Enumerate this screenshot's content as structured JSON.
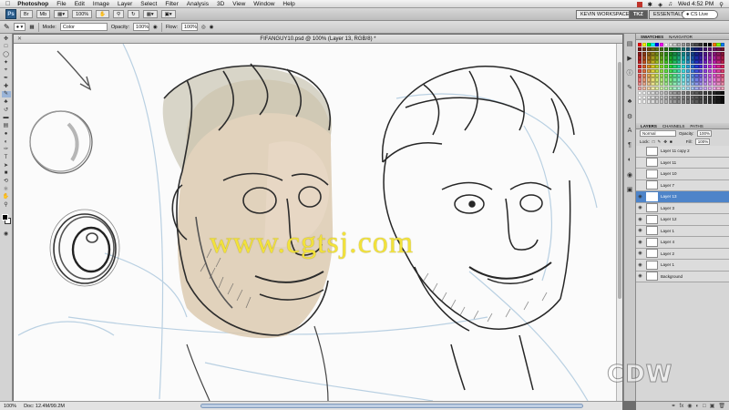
{
  "menubar": {
    "apple_icon": "apple-icon",
    "app_name": "Photoshop",
    "items": [
      "File",
      "Edit",
      "Image",
      "Layer",
      "Select",
      "Filter",
      "Analysis",
      "3D",
      "View",
      "Window",
      "Help"
    ],
    "clock": "Wed 4:52 PM"
  },
  "appbar": {
    "logo": "Ps",
    "zoom": "100%",
    "workspace_name": "KEVIN WORKSPACE",
    "tkz": "TKZ",
    "essentials": "ESSENTIALS",
    "cs_live": "CS Live"
  },
  "options": {
    "mode_label": "Mode:",
    "mode_value": "Color",
    "opacity_label": "Opacity:",
    "opacity_value": "100%",
    "flow_label": "Flow:",
    "flow_value": "100%"
  },
  "document": {
    "title": "FIFANGUY10.psd @ 100% (Layer 13, RGB/8) *",
    "zoom_status": "100%",
    "doc_status": "Doc: 12.4M/99.2M"
  },
  "panels": {
    "swatch_tabs": [
      "SWATCHES",
      "NAVIGATOR"
    ],
    "layer_tabs": [
      "LAYERS",
      "CHANNELS",
      "PATHS"
    ],
    "blend_mode": "Normal",
    "opacity_label": "Opacity:",
    "opacity_value": "100%",
    "lock_label": "Lock:",
    "fill_label": "Fill:",
    "fill_value": "100%",
    "layers": [
      {
        "name": "Layer 11 copy 2",
        "visible": false,
        "selected": false
      },
      {
        "name": "Layer 11",
        "visible": false,
        "selected": false
      },
      {
        "name": "Layer 10",
        "visible": false,
        "selected": false
      },
      {
        "name": "Layer 7",
        "visible": false,
        "selected": false
      },
      {
        "name": "Layer 13",
        "visible": true,
        "selected": true
      },
      {
        "name": "Layer 3",
        "visible": true,
        "selected": false
      },
      {
        "name": "Layer 12",
        "visible": true,
        "selected": false
      },
      {
        "name": "Layer 1",
        "visible": true,
        "selected": false
      },
      {
        "name": "Layer 4",
        "visible": true,
        "selected": false
      },
      {
        "name": "Layer 2",
        "visible": true,
        "selected": false
      },
      {
        "name": "Layer 1",
        "visible": true,
        "selected": false
      },
      {
        "name": "Background",
        "visible": true,
        "selected": false
      }
    ]
  },
  "watermarks": {
    "site": "www.cgtsj.com",
    "brand": "CDW"
  },
  "colors": {
    "selected_layer": "#4e84c9",
    "watermark_yellow": "#f2e23a",
    "skin_tone": "#dccab0"
  }
}
